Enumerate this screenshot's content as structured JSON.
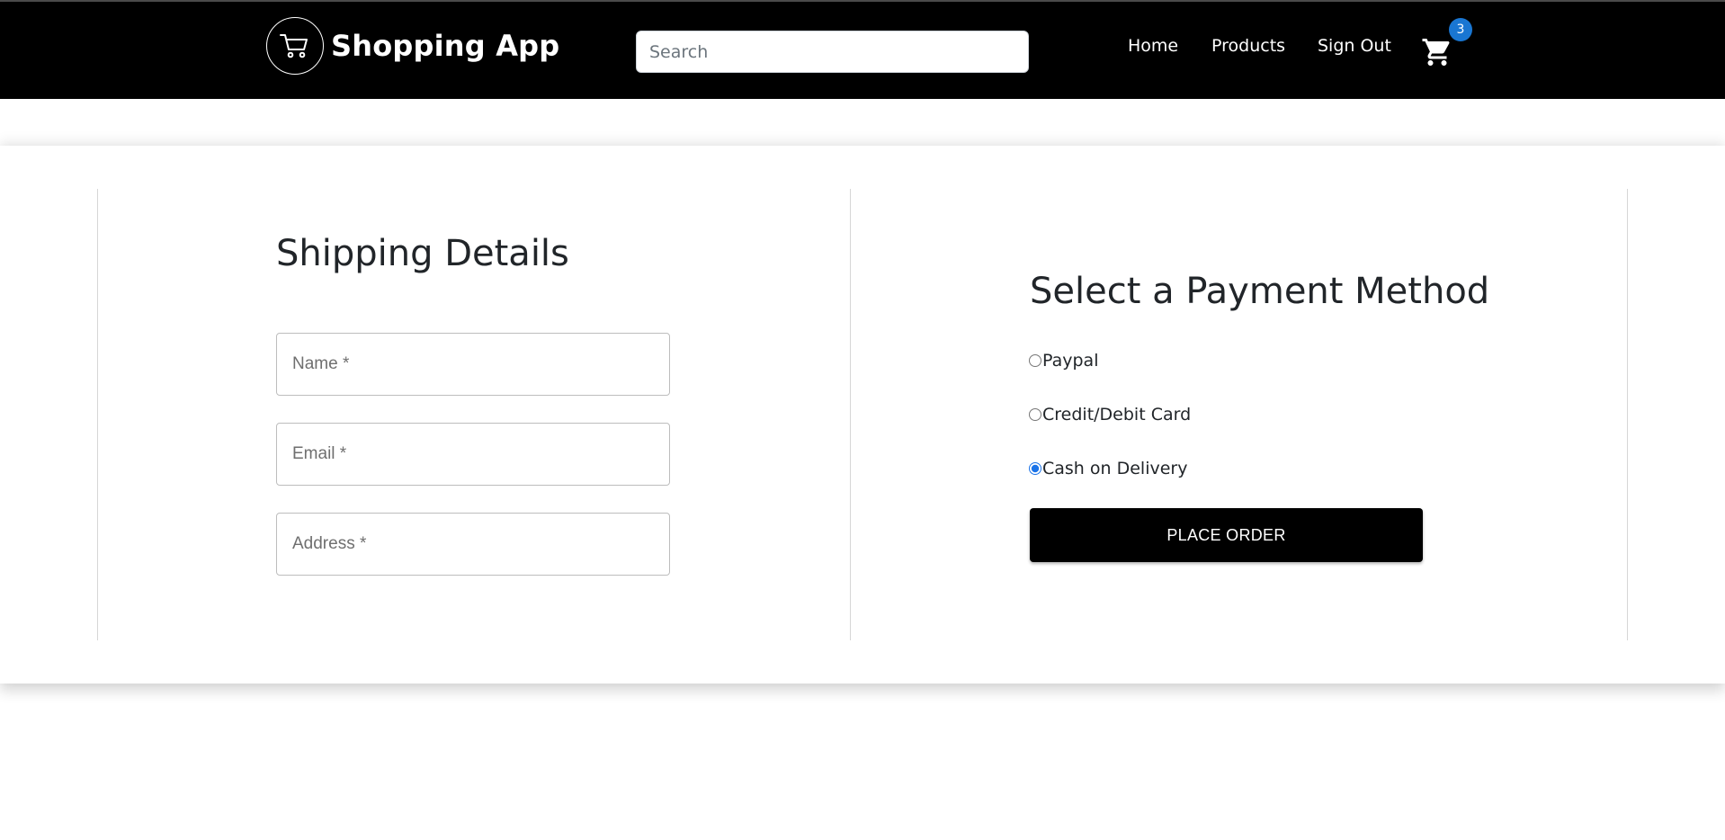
{
  "app": {
    "brand_name": "Shopping App"
  },
  "navbar": {
    "search_placeholder": "Search",
    "links": [
      {
        "label": "Home"
      },
      {
        "label": "Products"
      },
      {
        "label": "Sign Out"
      }
    ],
    "cart_count": "3",
    "background_color": "#000000",
    "badge_color": "#1976d2"
  },
  "shipping": {
    "title": "Shipping Details",
    "fields": {
      "name": {
        "placeholder": "Name *",
        "value": ""
      },
      "email": {
        "placeholder": "Email *",
        "value": ""
      },
      "address": {
        "placeholder": "Address *",
        "value": ""
      }
    }
  },
  "payment": {
    "title": "Select a Payment Method",
    "options": [
      {
        "label": "Paypal",
        "checked": false
      },
      {
        "label": "Credit/Debit Card",
        "checked": false
      },
      {
        "label": "Cash on Delivery",
        "checked": true
      }
    ],
    "submit_label": "PLACE ORDER",
    "accent_color": "#1a73e8"
  },
  "icons": {
    "brand_logo": "shopping-cart-outline-icon",
    "cart": "shopping-cart-icon"
  }
}
